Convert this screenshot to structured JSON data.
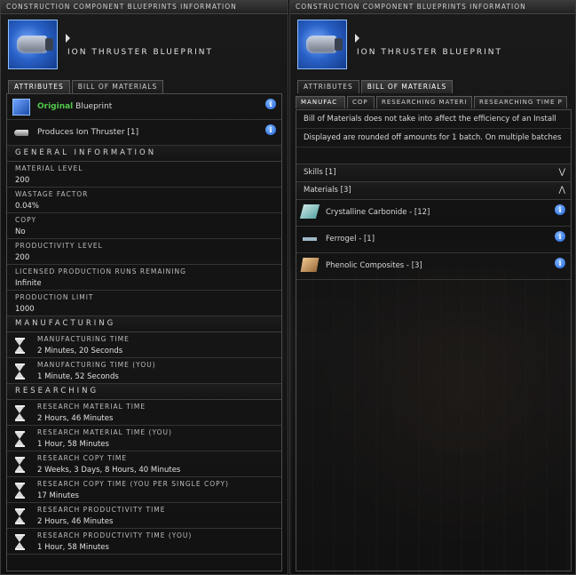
{
  "window_title": "CONSTRUCTION COMPONENT BLUEPRINTS INFORMATION",
  "item_title": "ION THRUSTER BLUEPRINT",
  "tabs": [
    "ATTRIBUTES",
    "BILL OF MATERIALS"
  ],
  "left": {
    "top_items": [
      {
        "prefix": "Original",
        "label": "Blueprint",
        "icon": "blueprint-icon"
      },
      {
        "label": "Produces Ion Thruster [1]",
        "icon": "ion-thruster-icon"
      }
    ],
    "sections": {
      "general": "GENERAL INFORMATION",
      "manufacturing": "MANUFACTURING",
      "researching": "RESEARCHING"
    },
    "attributes": [
      {
        "key": "MATERIAL LEVEL",
        "value": "200"
      },
      {
        "key": "WASTAGE FACTOR",
        "value": "0.04%"
      },
      {
        "key": "COPY",
        "value": "No"
      },
      {
        "key": "PRODUCTIVITY LEVEL",
        "value": "200"
      },
      {
        "key": "LICENSED PRODUCTION RUNS REMAINING",
        "value": "Infinite"
      },
      {
        "key": "PRODUCTION LIMIT",
        "value": "1000"
      }
    ],
    "manufacturing": [
      {
        "key": "MANUFACTURING TIME",
        "value": "2 Minutes, 20 Seconds"
      },
      {
        "key": "MANUFACTURING TIME (YOU)",
        "value": "1 Minute, 52 Seconds"
      }
    ],
    "researching": [
      {
        "key": "RESEARCH MATERIAL TIME",
        "value": "2 Hours, 46 Minutes"
      },
      {
        "key": "RESEARCH MATERIAL TIME (YOU)",
        "value": "1 Hour, 58 Minutes"
      },
      {
        "key": "RESEARCH COPY TIME",
        "value": "2 Weeks, 3 Days, 8 Hours, 40 Minutes"
      },
      {
        "key": "RESEARCH COPY TIME (YOU PER SINGLE COPY)",
        "value": "17 Minutes"
      },
      {
        "key": "RESEARCH PRODUCTIVITY TIME",
        "value": "2 Hours, 46 Minutes"
      },
      {
        "key": "RESEARCH PRODUCTIVITY TIME (YOU)",
        "value": "1 Hour, 58 Minutes"
      }
    ]
  },
  "right": {
    "subtabs": [
      "MANUFAC",
      "COP",
      "RESEARCHING MATERI",
      "RESEARCHING TIME P"
    ],
    "notes": [
      "Bill of Materials does not take into affect the efficiency of an Install",
      "Displayed are rounded off amounts for 1 batch. On multiple batches"
    ],
    "groups": {
      "skills": "Skills [1]",
      "materials": "Materials [3]"
    },
    "materials": [
      {
        "label": "Crystalline Carbonide - [12]",
        "icon": "crystalline-carbonide-icon"
      },
      {
        "label": "Ferrogel - [1]",
        "icon": "ferrogel-icon"
      },
      {
        "label": "Phenolic Composites - [3]",
        "icon": "phenolic-composites-icon"
      }
    ]
  },
  "colors": {
    "original_text": "#52c84a",
    "info_icon": "#1f5fd8"
  }
}
